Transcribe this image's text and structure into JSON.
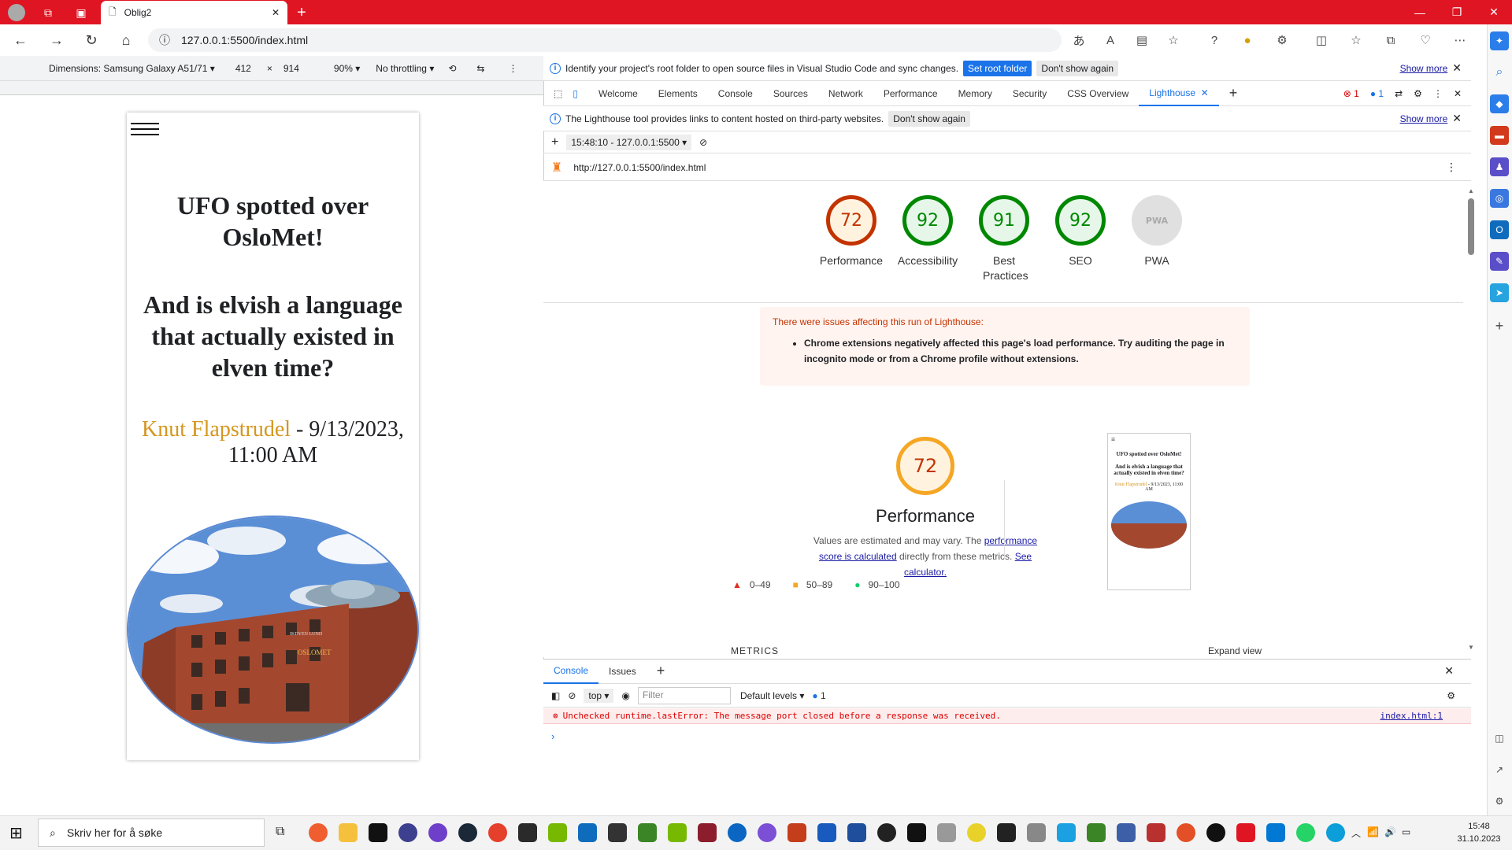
{
  "browser": {
    "tab_title": "Oblig2",
    "url": "127.0.0.1:5500/index.html"
  },
  "devbar": {
    "dimensions": "Dimensions: Samsung Galaxy A51/71",
    "width": "412",
    "times": "×",
    "height": "914",
    "zoom": "90%",
    "throttle": "No throttling"
  },
  "page": {
    "heading1": "UFO spotted over OsloMet!",
    "heading2": "And is elvish a language that actually existed in elven time?",
    "author": "Knut Flapstrudel",
    "date": " - 9/13/2023, 11:00 AM",
    "sign": "IKDYEN LUND",
    "logo_text": "OSLOMET"
  },
  "infobar1": {
    "text": "Identify your project's root folder to open source files in Visual Studio Code and sync changes.",
    "primary": "Set root folder",
    "secondary": "Don't show again",
    "more": "Show more"
  },
  "devtools_tabs": [
    "Welcome",
    "Elements",
    "Console",
    "Sources",
    "Network",
    "Performance",
    "Memory",
    "Security",
    "CSS Overview",
    "Lighthouse"
  ],
  "issue_counts": {
    "errors": "1",
    "messages": "1"
  },
  "infobar2": {
    "text": "The Lighthouse tool provides links to content hosted on third-party websites.",
    "secondary": "Don't show again",
    "more": "Show more"
  },
  "lighthouse": {
    "run": "15:48:10 - 127.0.0.1:5500",
    "url": "http://127.0.0.1:5500/index.html",
    "scores": [
      {
        "value": "72",
        "label": "Performance",
        "color": "#c33300",
        "bg": "#fff3e0"
      },
      {
        "value": "92",
        "label": "Accessibility",
        "color": "#008800",
        "bg": "#e6f7ea"
      },
      {
        "value": "91",
        "label": "Best Practices",
        "color": "#008800",
        "bg": "#e6f7ea"
      },
      {
        "value": "92",
        "label": "SEO",
        "color": "#008800",
        "bg": "#e6f7ea"
      },
      {
        "value": "PWA",
        "label": "PWA",
        "color": "#999999",
        "bg": "#e0e0e0"
      }
    ],
    "warn_title": "There were issues affecting this run of Lighthouse:",
    "warn_item": "Chrome extensions negatively affected this page's load performance. Try auditing the page in incognito mode or from a Chrome profile without extensions.",
    "perf_score": "72",
    "perf_title": "Performance",
    "desc1": "Values are estimated and may vary. The ",
    "desc_link1": "performance score is calculated",
    "desc2": " directly from these metrics. ",
    "desc_link2": "See calculator.",
    "legend": [
      "0–49",
      "50–89",
      "90–100"
    ],
    "thumb_h1": "UFO spotted over OsloMet!",
    "thumb_h2": "And is elvish a language that actually existed in elven time?",
    "thumb_author": "Knut Flapstrudel",
    "thumb_date": " - 9/13/2023, 11:00 AM",
    "metrics": "METRICS",
    "expand": "Expand view"
  },
  "console": {
    "tabs": [
      "Console",
      "Issues"
    ],
    "context": "top",
    "filter": "Filter",
    "levels": "Default levels",
    "msg_count": "1",
    "error": "Unchecked runtime.lastError: The message port closed before a response was received.",
    "source": "index.html:1"
  },
  "taskbar": {
    "search": "Skriv her for å søke",
    "time": "15:48",
    "date": "31.10.2023"
  }
}
